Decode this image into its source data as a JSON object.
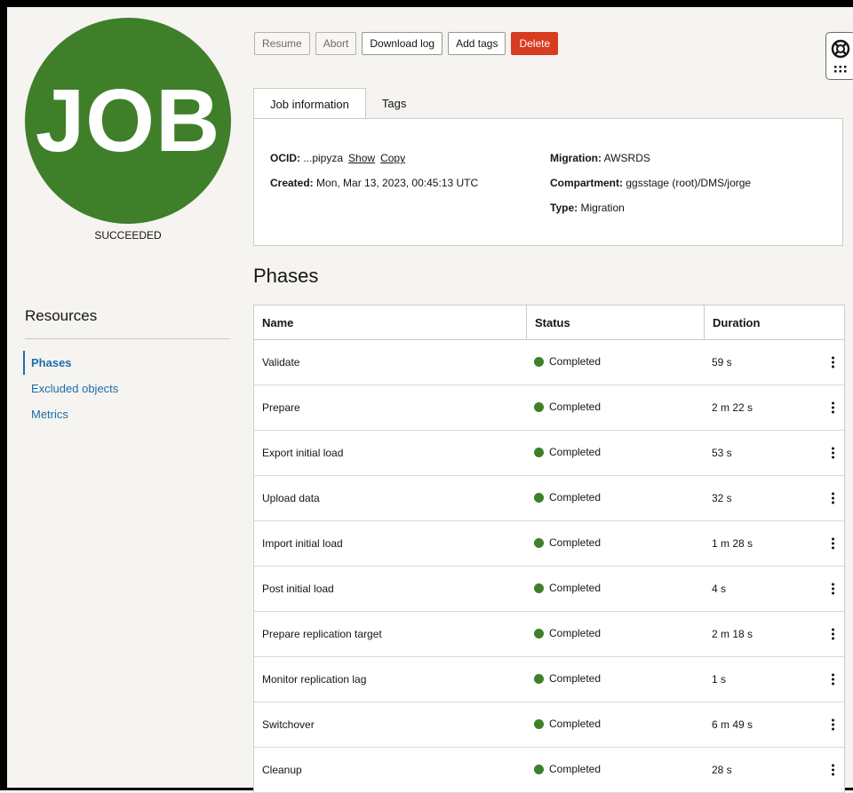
{
  "badge": {
    "text": "JOB",
    "status": "SUCCEEDED",
    "color": "#3f7f2a"
  },
  "actions": {
    "resume": "Resume",
    "abort": "Abort",
    "download_log": "Download log",
    "add_tags": "Add tags",
    "delete": "Delete"
  },
  "help_icon": "lifebuoy-icon",
  "tabs": [
    {
      "label": "Job information"
    },
    {
      "label": "Tags"
    }
  ],
  "info": {
    "ocid_label": "OCID:",
    "ocid_value": "...pipyza",
    "show": "Show",
    "copy": "Copy",
    "created_label": "Created:",
    "created_value": "Mon, Mar 13, 2023, 00:45:13 UTC",
    "migration_label": "Migration:",
    "migration_value": "AWSRDS",
    "compartment_label": "Compartment:",
    "compartment_value": "ggsstage (root)/DMS/jorge",
    "type_label": "Type:",
    "type_value": "Migration"
  },
  "resources": {
    "title": "Resources",
    "items": [
      {
        "label": "Phases"
      },
      {
        "label": "Excluded objects"
      },
      {
        "label": "Metrics"
      }
    ]
  },
  "phases": {
    "title": "Phases",
    "columns": [
      "Name",
      "Status",
      "Duration"
    ],
    "rows": [
      {
        "name": "Validate",
        "status": "Completed",
        "duration": "59 s"
      },
      {
        "name": "Prepare",
        "status": "Completed",
        "duration": "2 m 22 s"
      },
      {
        "name": "Export initial load",
        "status": "Completed",
        "duration": "53 s"
      },
      {
        "name": "Upload data",
        "status": "Completed",
        "duration": "32 s"
      },
      {
        "name": "Import initial load",
        "status": "Completed",
        "duration": "1 m 28 s"
      },
      {
        "name": "Post initial load",
        "status": "Completed",
        "duration": "4 s"
      },
      {
        "name": "Prepare replication target",
        "status": "Completed",
        "duration": "2 m 18 s"
      },
      {
        "name": "Monitor replication lag",
        "status": "Completed",
        "duration": "1 s"
      },
      {
        "name": "Switchover",
        "status": "Completed",
        "duration": "6 m 49 s"
      },
      {
        "name": "Cleanup",
        "status": "Completed",
        "duration": "28 s"
      }
    ]
  },
  "colors": {
    "accent": "#1b6ea8",
    "danger": "#d83b1f",
    "success": "#3f7f2a"
  }
}
